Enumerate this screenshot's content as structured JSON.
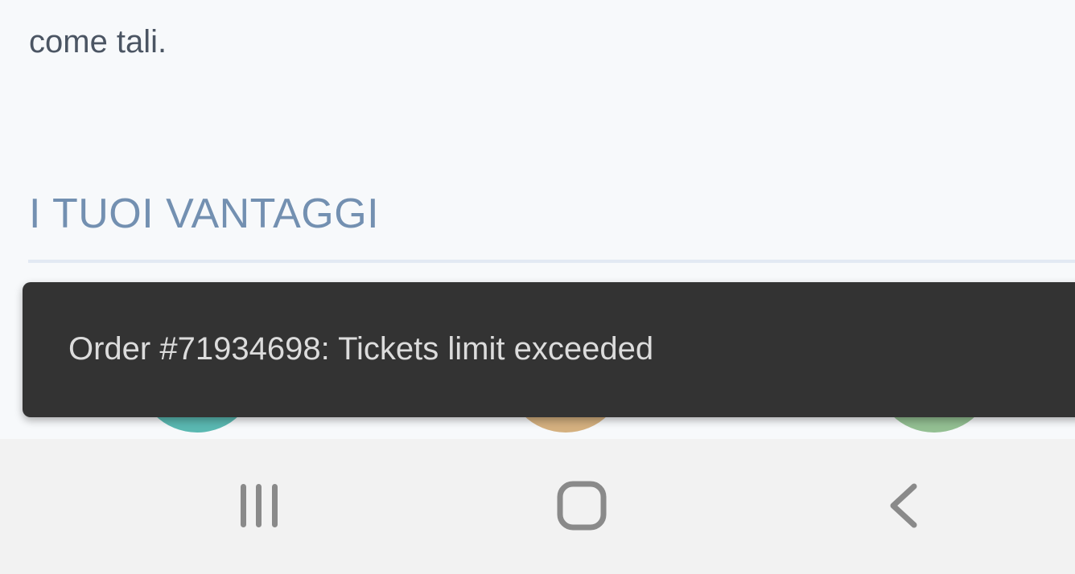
{
  "content": {
    "body_text": "come tali.",
    "section_heading": "I TUOI VANTAGGI"
  },
  "snackbar": {
    "message": "Order #71934698: Tickets limit exceeded"
  },
  "navbar": {
    "icons": [
      "recents-icon",
      "home-icon",
      "back-icon"
    ]
  },
  "colors": {
    "page_background": "#f7f9fb",
    "heading": "#7390b1",
    "snackbar_background": "#333333",
    "navbar_background": "#f2f2f2"
  }
}
